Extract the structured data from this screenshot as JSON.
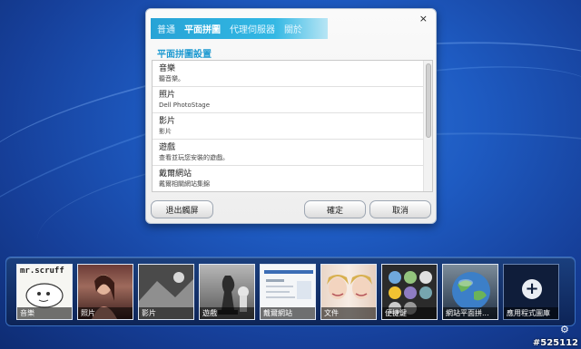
{
  "dialog": {
    "tabs": [
      "普通",
      "平面拼圖",
      "代理伺服器",
      "關於"
    ],
    "active_tab": 1,
    "close_icon": "×",
    "section_title": "平面拼圖設置",
    "items": [
      {
        "title": "音樂",
        "subtitle": "聽音樂。"
      },
      {
        "title": "照片",
        "subtitle": "Dell PhotoStage"
      },
      {
        "title": "影片",
        "subtitle": "影片"
      },
      {
        "title": "遊戲",
        "subtitle": "查看並玩您安裝的遊戲。"
      },
      {
        "title": "戴爾網站",
        "subtitle": "戴爾相關網站集錦"
      }
    ],
    "buttons": {
      "exit": "退出觸屏",
      "ok": "確定",
      "cancel": "取消"
    }
  },
  "taskbar": {
    "tiles": [
      {
        "label": "音樂",
        "thumb_text": "mr.scruff"
      },
      {
        "label": "照片"
      },
      {
        "label": "影片"
      },
      {
        "label": "遊戲"
      },
      {
        "label": "戴爾網站"
      },
      {
        "label": "文件"
      },
      {
        "label": "便捷鍵"
      },
      {
        "label": "網站平面拼..."
      },
      {
        "label": "應用程式圖庫"
      }
    ],
    "icons": {
      "add_icon": "+",
      "gear_icon": "⚙"
    }
  },
  "watermark": "#525112",
  "colors": {
    "accent": "#27a3d6",
    "section_title": "#1e9ad1",
    "desktop": "#1e5bc2"
  }
}
